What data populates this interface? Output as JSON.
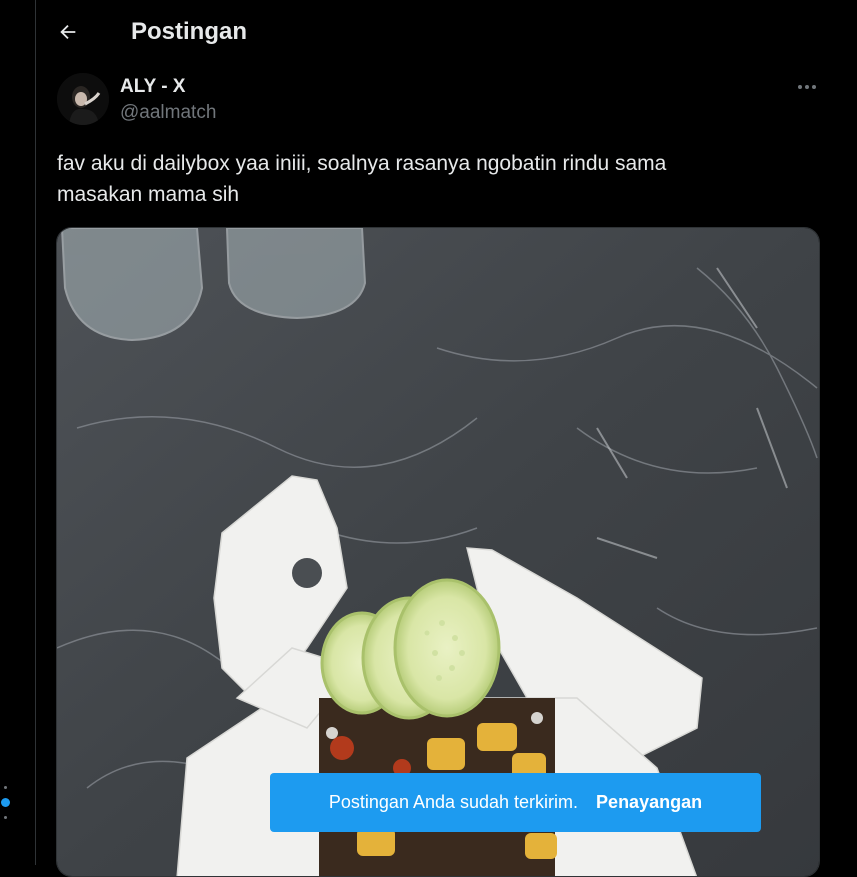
{
  "header": {
    "title": "Postingan",
    "back_icon": "arrow-left-icon"
  },
  "post": {
    "author": {
      "display_name": "ALY - X",
      "handle": "@aalmatch"
    },
    "more_icon": "more-horizontal-icon",
    "text_line1": "fav aku di dailybox yaa iniii, soalnya rasanya ngobatin rindu sama",
    "text_line2": "masakan mama sih"
  },
  "toast": {
    "message": "Postingan Anda sudah terkirim.",
    "action": "Penayangan"
  },
  "colors": {
    "background": "#000000",
    "text_primary": "#e7e9ea",
    "text_secondary": "#71767b",
    "accent": "#1d9bf0",
    "border": "#2f3336"
  }
}
